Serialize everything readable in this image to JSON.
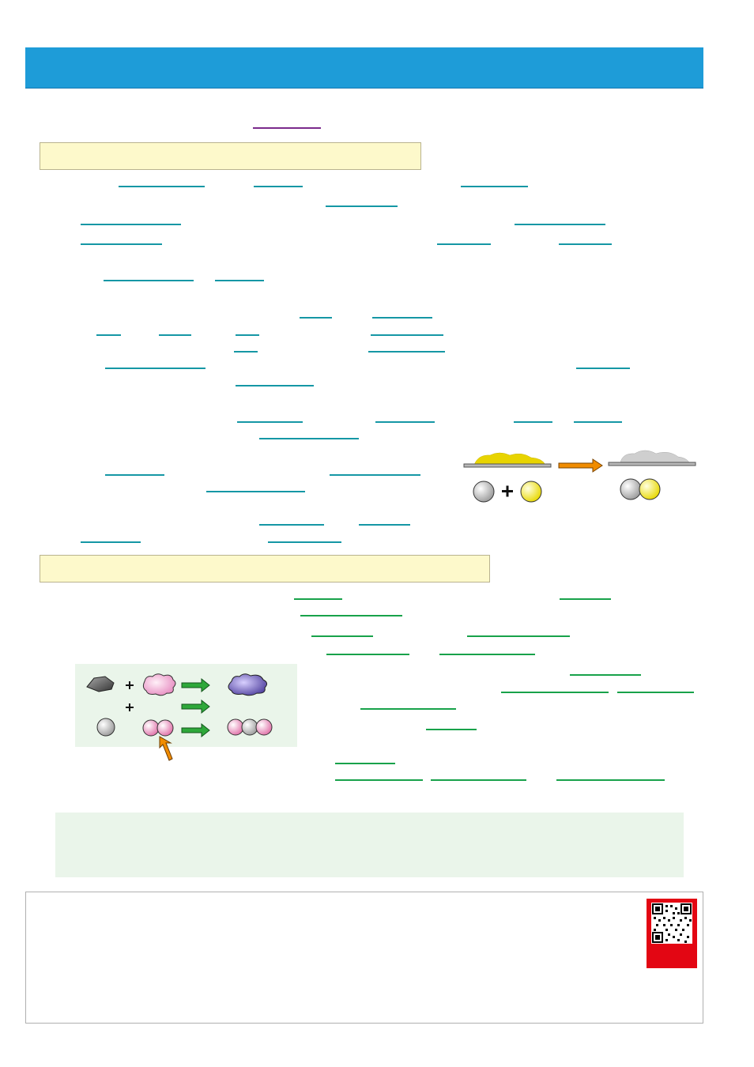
{
  "page": {
    "header_title": "",
    "section_heading_1": "",
    "section_heading_2": "",
    "note_text": ""
  },
  "colors": {
    "header_blue": "#1e9cd8",
    "heading_box": "#fdf9cb",
    "blank_teal": "#1597a5",
    "blank_green": "#18a24a",
    "blank_purple": "#7a2a8c",
    "arrow_orange": "#f08c00",
    "arrow_green": "#2ea83a",
    "qr_red": "#e30613"
  },
  "icons": {
    "diagram_1": [
      "yellow-powder-icon",
      "grey-powder-icon",
      "grey-atom-icon",
      "plus-icon",
      "yellow-atom-icon",
      "orange-arrow-icon",
      "compound-icon"
    ],
    "diagram_2": [
      "grey-rock-icon",
      "pink-cloud-icon",
      "green-arrow-icon",
      "purple-cloud-icon",
      "grey-atom-icon",
      "pink-molecule-icon",
      "orange-pointer-icon",
      "molecule-chain-icon"
    ],
    "footer": [
      "qr-code-icon"
    ]
  }
}
